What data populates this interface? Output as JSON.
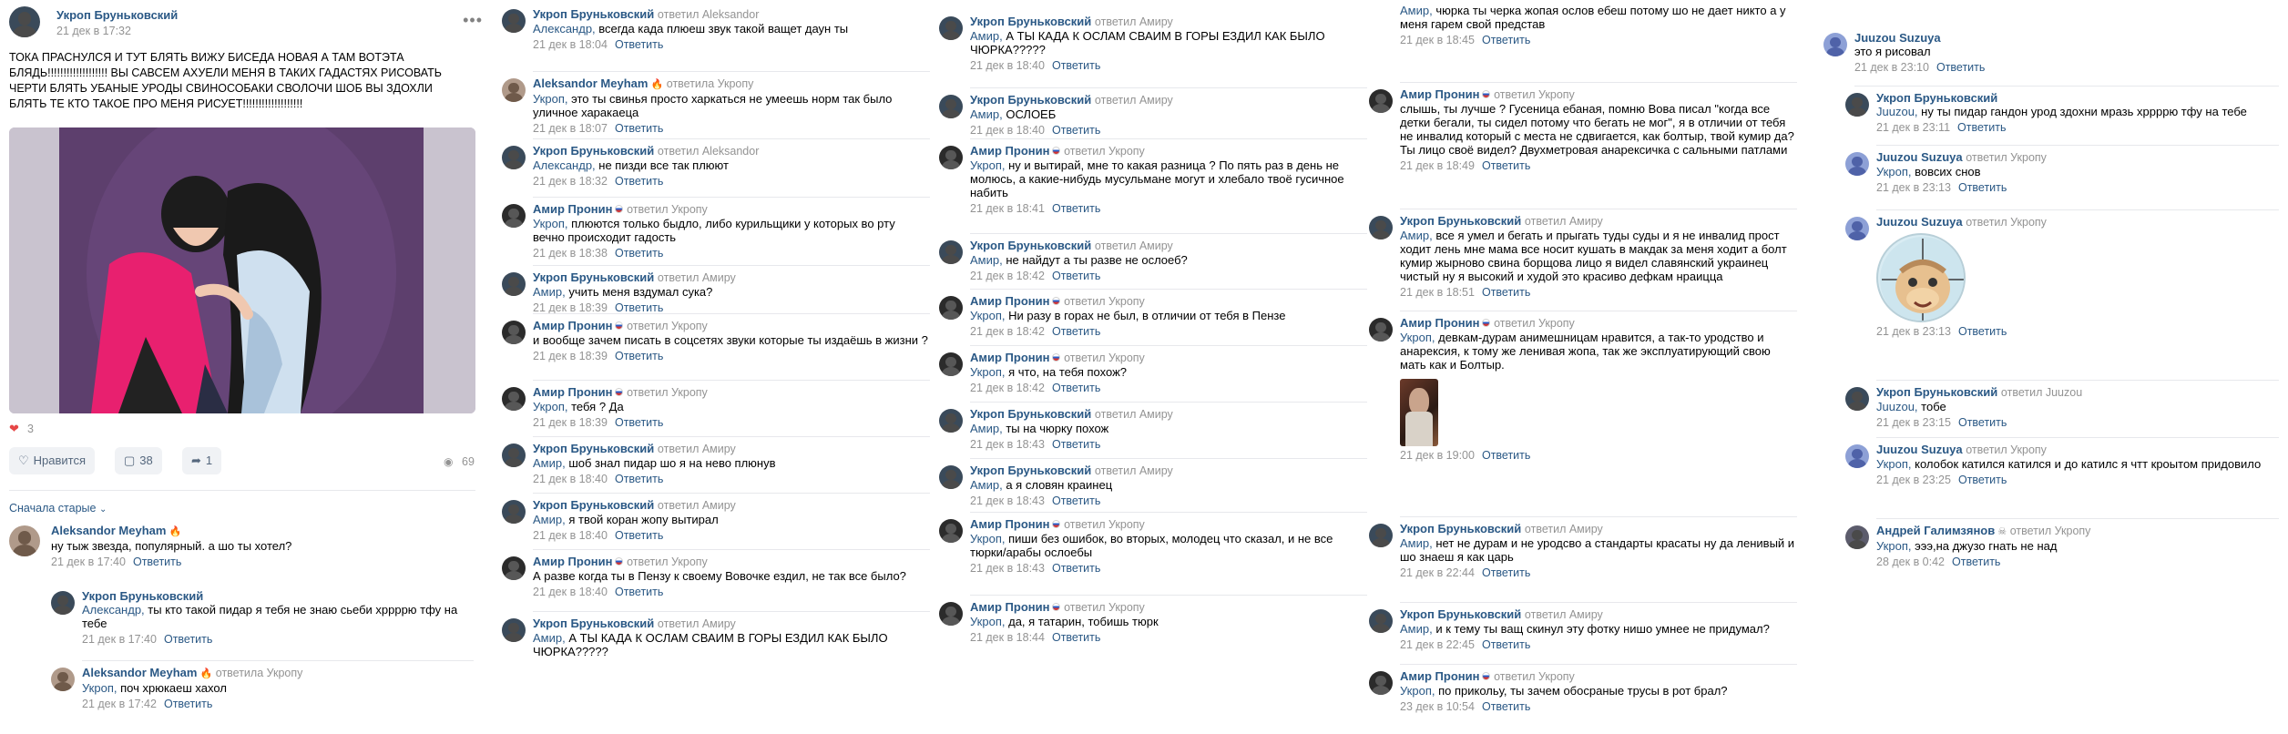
{
  "post": {
    "author": "Укроп Бруньковский",
    "date": "21 дек в 17:32",
    "menu_glyph": "•••",
    "text": "ТОКА ПРАСНУЛСЯ И ТУТ БЛЯТЬ ВИЖУ БИСЕДА НОВАЯ А ТАМ ВОТЭТА БЛЯДЬ!!!!!!!!!!!!!!!!!!! ВЫ САВСЕМ АХУЕЛИ МЕНЯ В ТАКИХ ГАДАСТЯХ РИСОВАТЬ ЧЕРТИ БЛЯТЬ УБАНЫЕ УРОДЫ СВИНОСОБАКИ СВОЛОЧИ ШОБ ВЫ ЗДОХЛИ БЛЯТЬ ТЕ КТО ТАКОЕ ПРО МЕНЯ РИСУЕТ!!!!!!!!!!!!!!!!!!!",
    "reactions_count": "3",
    "like_label": "Нравится",
    "comments_count": "38",
    "shares_count": "1",
    "views_count": "69",
    "sort_label": "Сначала старые"
  },
  "colors": {
    "link": "#2a5885",
    "muted": "#939393",
    "heart": "#e64646",
    "bg_button": "#f0f2f5"
  },
  "icons": {
    "heart": "heart-icon",
    "comment": "comment-icon",
    "share": "share-icon",
    "eye": "eye-icon",
    "chevron": "chevron-down-icon",
    "dots": "more-icon",
    "flag": "serbia-flag-icon",
    "fire": "fire-emoji-icon",
    "skull": "skull-emoji-icon"
  },
  "ui": {
    "answer": "Ответить",
    "replied": "ответил"
  },
  "col1": [
    {
      "name": "Aleksandor Meyham",
      "fire": true,
      "reply_to": "",
      "addressee": "",
      "text": "ну тыж звезда, популярный. а шо ты хотел?",
      "date": "21 дек в 17:40"
    },
    {
      "name": "Укроп Бруньковский",
      "reply_to": "",
      "addressee": "Александр,",
      "text": "ты кто такой пидар я тебя не знаю сьеби хррррю тфу на тебе",
      "date": "21 дек в 17:40"
    },
    {
      "name": "Aleksandor Meyham",
      "fire": true,
      "reply_to": "ответила Укропу",
      "addressee": "Укроп,",
      "text": "поч хрюкаеш хахол",
      "date": "21 дек в 17:42"
    }
  ],
  "col2": [
    {
      "name": "Укроп Бруньковский",
      "reply_to": "ответил Aleksandor",
      "addressee": "Александр,",
      "text": "всегда када плюеш звук такой ващет даун ты",
      "date": "21 дек в 18:04"
    },
    {
      "name": "Aleksandor Meyham",
      "fire": true,
      "reply_to": "ответила Укропу",
      "addressee": "Укроп,",
      "text": "это ты свинья просто харкаться не умеешь норм так было уличное харакаеца",
      "date": "21 дек в 18:07"
    },
    {
      "name": "Укроп Бруньковский",
      "reply_to": "ответил Aleksandor",
      "addressee": "Александр,",
      "text": "не пизди все так плюют",
      "date": "21 дек в 18:32"
    },
    {
      "name": "Амир Пронин",
      "flag": true,
      "reply_to": "ответил Укропу",
      "addressee": "Укроп,",
      "text": "плюются только быдло, либо курильщики у которых во рту вечно происходит гадость",
      "date": "21 дек в 18:38"
    },
    {
      "name": "Укроп Бруньковский",
      "reply_to": "ответил Амиру",
      "addressee": "Амир,",
      "text": "учить меня вздумал сука?",
      "date": "21 дек в 18:39"
    },
    {
      "name": "Амир Пронин",
      "flag": true,
      "reply_to": "ответил Укропу",
      "addressee": "",
      "text": "и вообще зачем писать в соцсетях звуки которые ты издаёшь в жизни ?",
      "date": "21 дек в 18:39"
    },
    {
      "name": "Амир Пронин",
      "flag": true,
      "reply_to": "ответил Укропу",
      "addressee": "Укроп,",
      "text": "тебя ? Да",
      "date": "21 дек в 18:39"
    },
    {
      "name": "Укроп Бруньковский",
      "reply_to": "ответил Амиру",
      "addressee": "Амир,",
      "text": "шоб знал пидар шо я на нево плюнув",
      "date": "21 дек в 18:40"
    },
    {
      "name": "Укроп Бруньковский",
      "reply_to": "ответил Амиру",
      "addressee": "Амир,",
      "text": "я твой коран жопу вытирал",
      "date": "21 дек в 18:40"
    },
    {
      "name": "Амир Пронин",
      "flag": true,
      "reply_to": "ответил Укропу",
      "addressee": "",
      "text": "А разве когда ты в Пензу к своему Вовочке ездил, не так все было?",
      "date": "21 дек в 18:40"
    },
    {
      "name": "Укроп Бруньковский",
      "reply_to": "ответил Амиру",
      "addressee": "Амир,",
      "text": "А ТЫ КАДА К ОСЛАМ СВАИМ В ГОРЫ ЕЗДИЛ КАК БЫЛО ЧЮРКА?????",
      "date": ""
    }
  ],
  "col3": [
    {
      "name": "Укроп Бруньковский",
      "reply_to": "ответил Амиру",
      "addressee": "Амир,",
      "text": "А ТЫ КАДА К ОСЛАМ СВАИМ В ГОРЫ ЕЗДИЛ КАК БЫЛО ЧЮРКА?????",
      "date": "21 дек в 18:40"
    },
    {
      "name": "Укроп Бруньковский",
      "reply_to": "ответил Амиру",
      "addressee": "Амир,",
      "text": "ОСЛОЕБ",
      "date": "21 дек в 18:40"
    },
    {
      "name": "Амир Пронин",
      "flag": true,
      "reply_to": "ответил Укропу",
      "addressee": "Укроп,",
      "text": "ну и вытирай, мне то какая разница ? По пять раз в день не молюсь, а какие-нибудь мусульмане могут и хлебало твоё гусичное набить",
      "date": "21 дек в 18:41"
    },
    {
      "name": "Укроп Бруньковский",
      "reply_to": "ответил Амиру",
      "addressee": "Амир,",
      "text": "не найдут а ты разве не ослоеб?",
      "date": "21 дек в 18:42"
    },
    {
      "name": "Амир Пронин",
      "flag": true,
      "reply_to": "ответил Укропу",
      "addressee": "Укроп,",
      "text": "Ни разу в горах не был, в отличии от тебя в Пензе",
      "date": "21 дек в 18:42"
    },
    {
      "name": "Амир Пронин",
      "flag": true,
      "reply_to": "ответил Укропу",
      "addressee": "Укроп,",
      "text": "я что, на тебя похож?",
      "date": "21 дек в 18:42"
    },
    {
      "name": "Укроп Бруньковский",
      "reply_to": "ответил Амиру",
      "addressee": "Амир,",
      "text": "ты на чюрку похож",
      "date": "21 дек в 18:43"
    },
    {
      "name": "Укроп Бруньковский",
      "reply_to": "ответил Амиру",
      "addressee": "Амир,",
      "text": "а я словян краинец",
      "date": "21 дек в 18:43"
    },
    {
      "name": "Амир Пронин",
      "flag": true,
      "reply_to": "ответил Укропу",
      "addressee": "Укроп,",
      "text": "пиши без ошибок, во вторых, молодец что сказал, и не все тюрки/арабы ослоебы",
      "date": "21 дек в 18:43"
    },
    {
      "name": "Амир Пронин",
      "flag": true,
      "reply_to": "ответил Укропу",
      "addressee": "Укроп,",
      "text": "да, я татарин, тобишь тюрк",
      "date": "21 дек в 18:44"
    }
  ],
  "col4": [
    {
      "name": "",
      "reply_to": "",
      "addressee": "Амир,",
      "text": "чюрка ты черка жопая ослов ебеш потому шо не дает никто а у меня гарем свой представ",
      "date": "21 дек в 18:45",
      "continuation": true
    },
    {
      "name": "Амир Пронин",
      "flag": true,
      "reply_to": "ответил Укропу",
      "addressee": "",
      "text": "слышь, ты лучше ? Гусеница ебаная, помню Вова писал \"когда все детки бегали, ты сидел потому что бегать не мог\", я в отличии от тебя не инвалид который с места не сдвигается, как болтыр, твой кумир да? Ты лицо своё видел? Двухметровая анарексичка с сальными патлами",
      "date": "21 дек в 18:49"
    },
    {
      "name": "Укроп Бруньковский",
      "reply_to": "ответил Амиру",
      "addressee": "Амир,",
      "text": "все я умел и бегать и прыгать туды суды и я не инвалид прост ходит лень мне мама все носит кушать в макдак за меня ходит а болт кумир жырново свина борщова лицо я видел славянский украинец чистый ну я высокий и худой это красиво дефкам нраицца",
      "date": "21 дек в 18:51"
    },
    {
      "name": "Амир Пронин",
      "flag": true,
      "reply_to": "ответил Укропу",
      "addressee": "Укроп,",
      "text": "девкам-дурам анимешницам нравится, а так-то уродство и анарексия, к тому же ленивая жопа, так же эксплуатирующий свою мать как и Болтыр.",
      "date": "21 дек в 19:00",
      "has_photo": true
    },
    {
      "name": "Укроп Бруньковский",
      "reply_to": "ответил Амиру",
      "addressee": "Амир,",
      "text": "нет не дурам и не уродсво а стандарты красаты ну да ленивый и шо знаеш я как царь",
      "date": "21 дек в 22:44"
    },
    {
      "name": "Укроп Бруньковский",
      "reply_to": "ответил Амиру",
      "addressee": "Амир,",
      "text": "и к тему ты ващ скинул эту фотку нишо умнее не придумал?",
      "date": "21 дек в 22:45"
    },
    {
      "name": "Амир Пронин",
      "flag": true,
      "reply_to": "ответил Укропу",
      "addressee": "Укроп,",
      "text": "по прикольу, ты зачем обосраные трусы в рот брал?",
      "date": "23 дек в 10:54"
    }
  ],
  "col5": [
    {
      "name": "Juuzou Suzuya",
      "reply_to": "",
      "addressee": "",
      "text": "это я рисовал",
      "date": "21 дек в 23:10",
      "top": true
    },
    {
      "name": "Укроп Бруньковский",
      "reply_to": "",
      "addressee": "Juuzou,",
      "text": "ну ты пидар гандон урод здохни мразь хррррю тфу на тебе",
      "date": "21 дек в 23:11"
    },
    {
      "name": "Juuzou Suzuya",
      "reply_to": "ответил Укропу",
      "addressee": "Укроп,",
      "text": "вовсих снов",
      "date": "21 дек в 23:13"
    },
    {
      "name": "Juuzou Suzuya",
      "reply_to": "ответил Укропу",
      "addressee": "",
      "text": "",
      "date": "21 дек в 23:13",
      "has_sticker": true
    },
    {
      "name": "Укроп Бруньковский",
      "reply_to": "ответил Juuzou",
      "addressee": "Juuzou,",
      "text": "тобе",
      "date": "21 дек в 23:15"
    },
    {
      "name": "Juuzou Suzuya",
      "reply_to": "ответил Укропу",
      "addressee": "Укроп,",
      "text": "колобок катился катился и до катилс я чтт кроытом придовило",
      "date": "21 дек в 23:25"
    },
    {
      "name": "Андрей Галимзянов",
      "skull": true,
      "reply_to": "ответил Укропу",
      "addressee": "Укроп,",
      "text": "эээ,на джузо гнать не над",
      "date": "28 дек в 0:42"
    }
  ]
}
